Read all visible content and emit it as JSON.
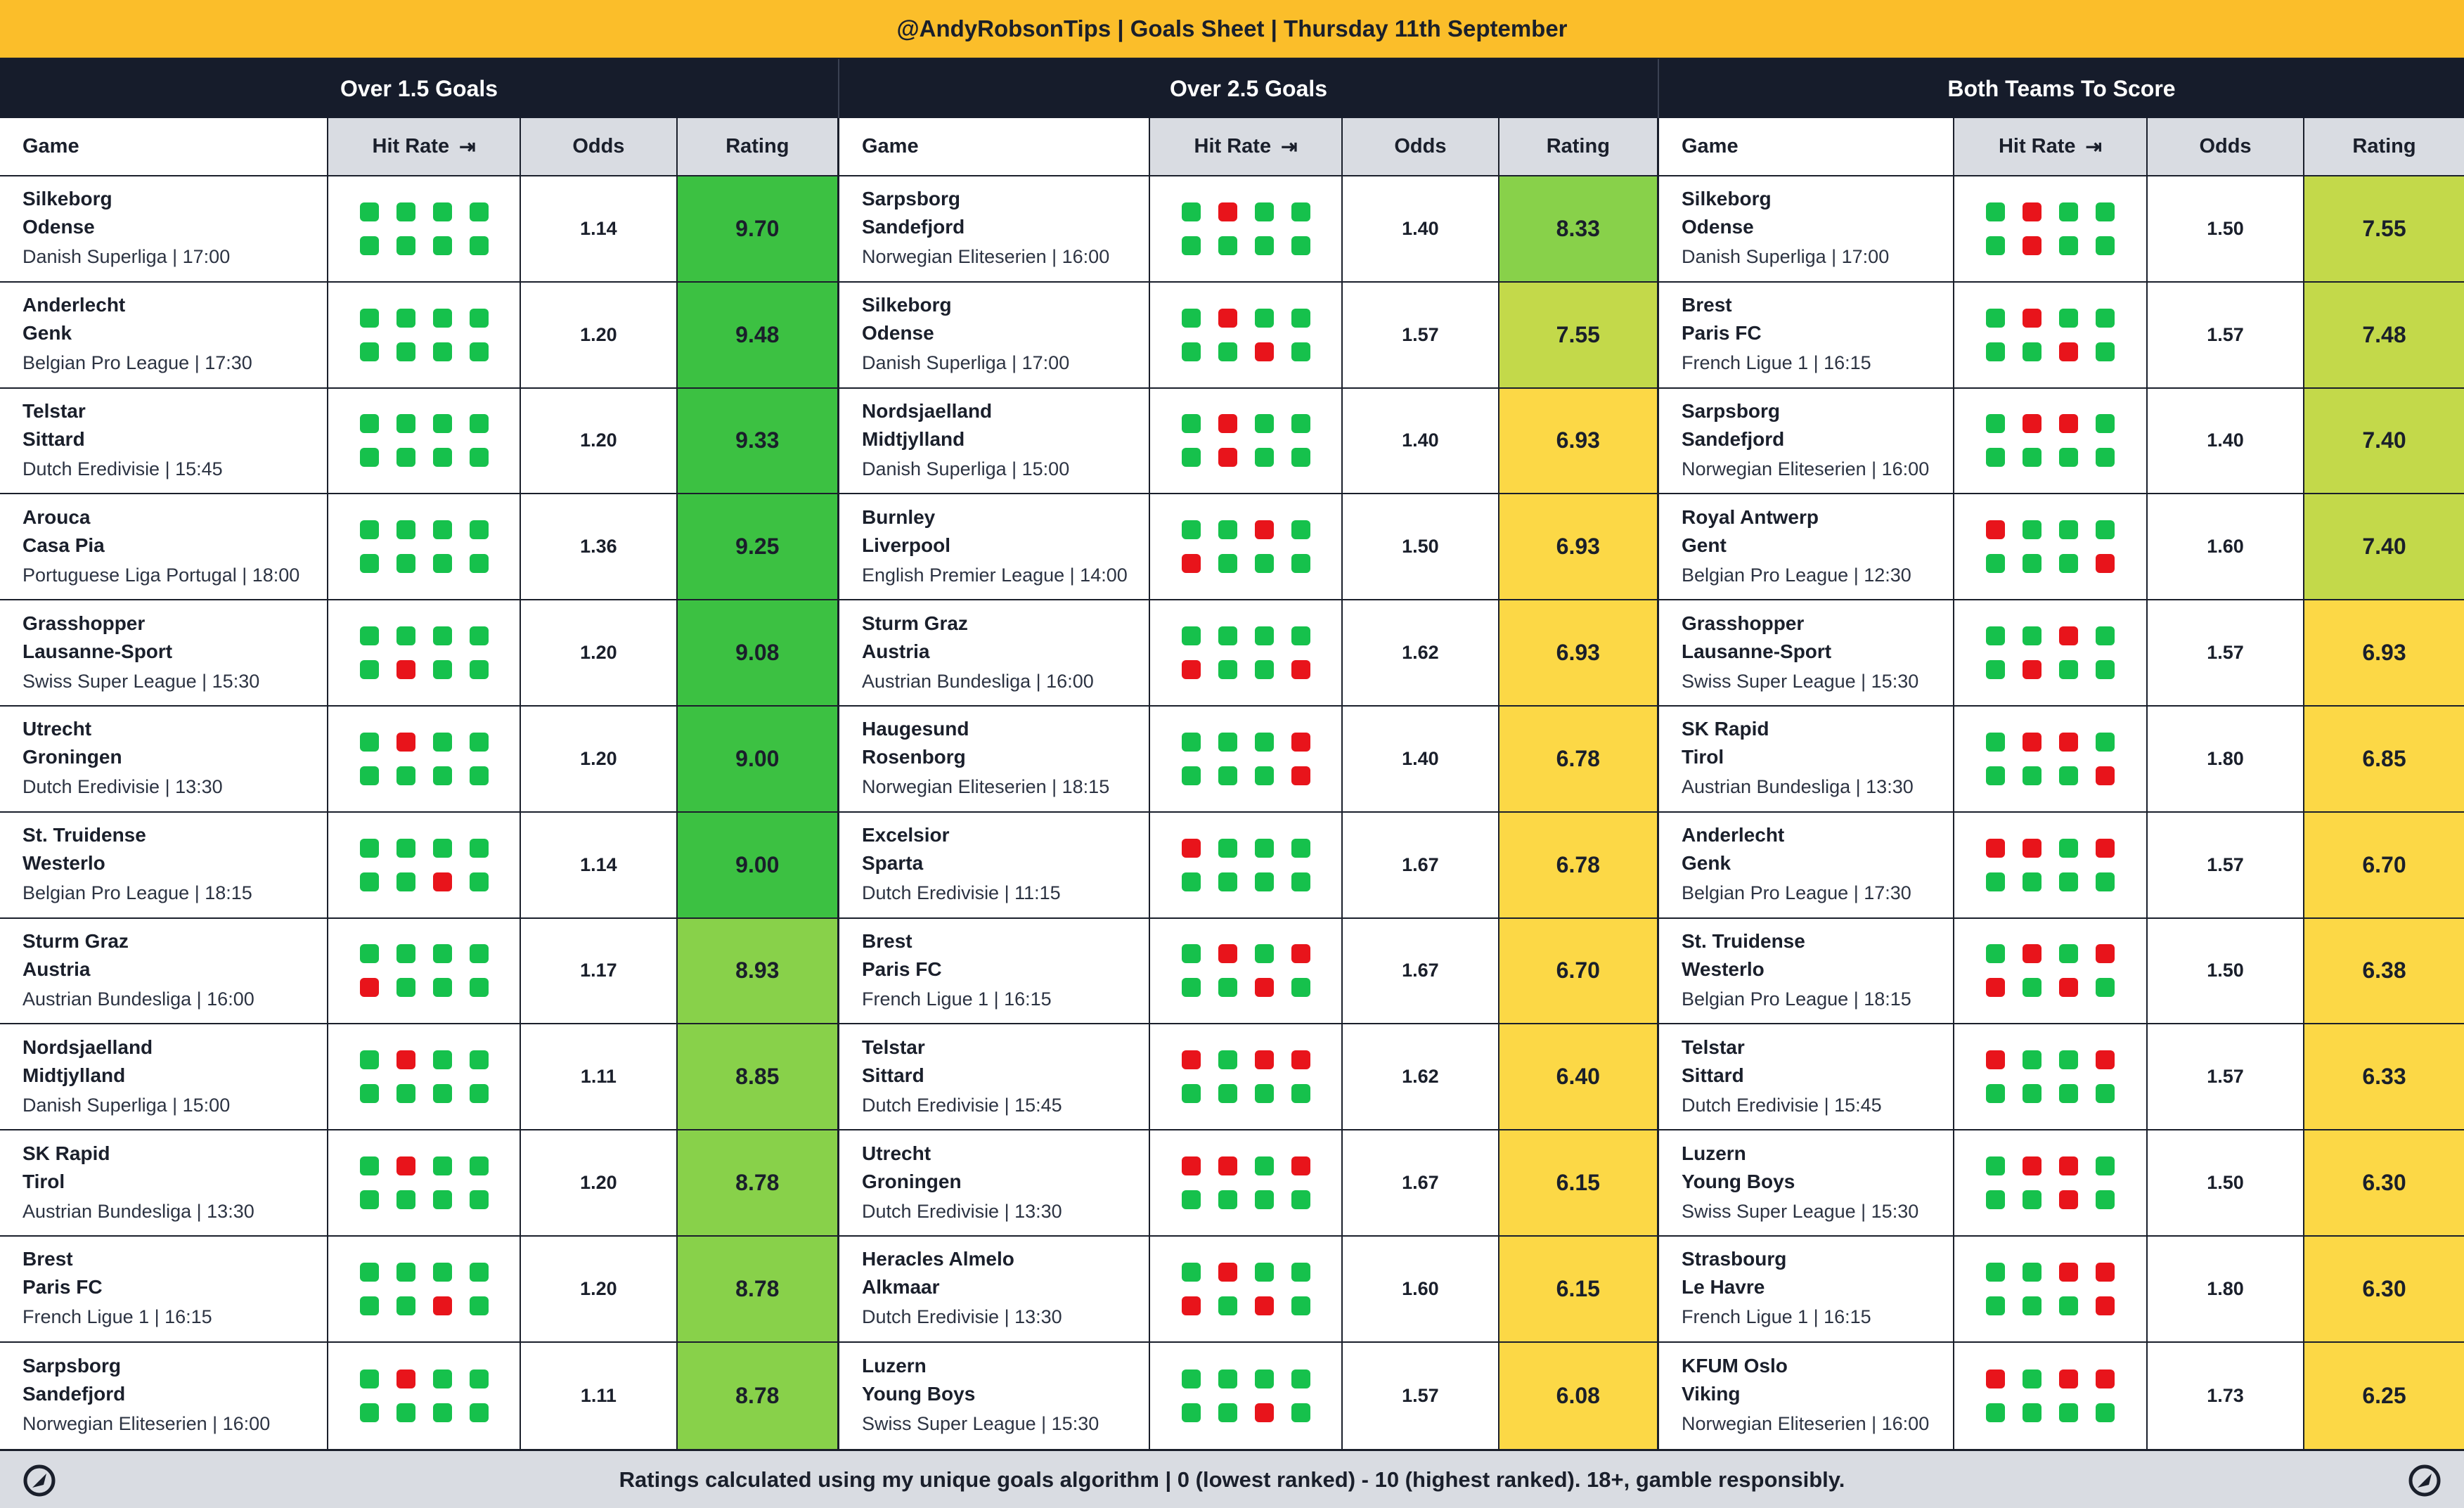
{
  "title": "@AndyRobsonTips | Goals Sheet | Thursday 11th September",
  "footer": "Ratings calculated using my unique goals algorithm | 0 (lowest ranked) - 10 (highest ranked). 18+, gamble responsibly.",
  "icons": {
    "logo": "brand-logo-icon",
    "hit_rate_arrow": "arrow-right-to-bar-icon"
  },
  "colors": {
    "hit": "#16c14c",
    "miss": "#e8141b",
    "title_bg": "#fbbe2a",
    "header_bg": "#161c2b",
    "rating_top": "#3cc142",
    "rating_mid": "#88d14a",
    "rating_low": "#c3d94a",
    "rating_yellow": "#fcd846"
  },
  "columns": {
    "game": "Game",
    "hit_rate": "Hit Rate",
    "hit_rate_arrow": "⇥",
    "odds": "Odds",
    "rating": "Rating"
  },
  "sections": [
    {
      "title": "Over 1.5 Goals",
      "rows": [
        {
          "home": "Silkeborg",
          "away": "Odense",
          "league": "Danish Superliga | 17:00",
          "hits": [
            "g",
            "g",
            "g",
            "g",
            "g",
            "g",
            "g",
            "g"
          ],
          "odds": "1.14",
          "rating": "9.70",
          "color": "#3cc142"
        },
        {
          "home": "Anderlecht",
          "away": "Genk",
          "league": "Belgian Pro League | 17:30",
          "hits": [
            "g",
            "g",
            "g",
            "g",
            "g",
            "g",
            "g",
            "g"
          ],
          "odds": "1.20",
          "rating": "9.48",
          "color": "#3cc142"
        },
        {
          "home": "Telstar",
          "away": "Sittard",
          "league": "Dutch Eredivisie | 15:45",
          "hits": [
            "g",
            "g",
            "g",
            "g",
            "g",
            "g",
            "g",
            "g"
          ],
          "odds": "1.20",
          "rating": "9.33",
          "color": "#3cc142"
        },
        {
          "home": "Arouca",
          "away": "Casa Pia",
          "league": "Portuguese Liga Portugal | 18:00",
          "hits": [
            "g",
            "g",
            "g",
            "g",
            "g",
            "g",
            "g",
            "g"
          ],
          "odds": "1.36",
          "rating": "9.25",
          "color": "#3cc142"
        },
        {
          "home": "Grasshopper",
          "away": "Lausanne-Sport",
          "league": "Swiss Super League | 15:30",
          "hits": [
            "g",
            "g",
            "g",
            "g",
            "g",
            "r",
            "g",
            "g"
          ],
          "odds": "1.20",
          "rating": "9.08",
          "color": "#3cc142"
        },
        {
          "home": "Utrecht",
          "away": "Groningen",
          "league": "Dutch Eredivisie | 13:30",
          "hits": [
            "g",
            "r",
            "g",
            "g",
            "g",
            "g",
            "g",
            "g"
          ],
          "odds": "1.20",
          "rating": "9.00",
          "color": "#3cc142"
        },
        {
          "home": "St. Truidense",
          "away": "Westerlo",
          "league": "Belgian Pro League | 18:15",
          "hits": [
            "g",
            "g",
            "g",
            "g",
            "g",
            "g",
            "r",
            "g"
          ],
          "odds": "1.14",
          "rating": "9.00",
          "color": "#3cc142"
        },
        {
          "home": "Sturm Graz",
          "away": "Austria",
          "league": "Austrian Bundesliga | 16:00",
          "hits": [
            "g",
            "g",
            "g",
            "g",
            "r",
            "g",
            "g",
            "g"
          ],
          "odds": "1.17",
          "rating": "8.93",
          "color": "#88d14a"
        },
        {
          "home": "Nordsjaelland",
          "away": "Midtjylland",
          "league": "Danish Superliga | 15:00",
          "hits": [
            "g",
            "r",
            "g",
            "g",
            "g",
            "g",
            "g",
            "g"
          ],
          "odds": "1.11",
          "rating": "8.85",
          "color": "#88d14a"
        },
        {
          "home": "SK Rapid",
          "away": "Tirol",
          "league": "Austrian Bundesliga | 13:30",
          "hits": [
            "g",
            "r",
            "g",
            "g",
            "g",
            "g",
            "g",
            "g"
          ],
          "odds": "1.20",
          "rating": "8.78",
          "color": "#88d14a"
        },
        {
          "home": "Brest",
          "away": "Paris FC",
          "league": "French Ligue 1 | 16:15",
          "hits": [
            "g",
            "g",
            "g",
            "g",
            "g",
            "g",
            "r",
            "g"
          ],
          "odds": "1.20",
          "rating": "8.78",
          "color": "#88d14a"
        },
        {
          "home": "Sarpsborg",
          "away": "Sandefjord",
          "league": "Norwegian Eliteserien | 16:00",
          "hits": [
            "g",
            "r",
            "g",
            "g",
            "g",
            "g",
            "g",
            "g"
          ],
          "odds": "1.11",
          "rating": "8.78",
          "color": "#88d14a"
        }
      ]
    },
    {
      "title": "Over 2.5 Goals",
      "rows": [
        {
          "home": "Sarpsborg",
          "away": "Sandefjord",
          "league": "Norwegian Eliteserien | 16:00",
          "hits": [
            "g",
            "r",
            "g",
            "g",
            "g",
            "g",
            "g",
            "g"
          ],
          "odds": "1.40",
          "rating": "8.33",
          "color": "#88d14a"
        },
        {
          "home": "Silkeborg",
          "away": "Odense",
          "league": "Danish Superliga | 17:00",
          "hits": [
            "g",
            "r",
            "g",
            "g",
            "g",
            "g",
            "r",
            "g"
          ],
          "odds": "1.57",
          "rating": "7.55",
          "color": "#c3d94a"
        },
        {
          "home": "Nordsjaelland",
          "away": "Midtjylland",
          "league": "Danish Superliga | 15:00",
          "hits": [
            "g",
            "r",
            "g",
            "g",
            "g",
            "r",
            "g",
            "g"
          ],
          "odds": "1.40",
          "rating": "6.93",
          "color": "#fcd846"
        },
        {
          "home": "Burnley",
          "away": "Liverpool",
          "league": "English Premier League | 14:00",
          "hits": [
            "g",
            "g",
            "r",
            "g",
            "r",
            "g",
            "g",
            "g"
          ],
          "odds": "1.50",
          "rating": "6.93",
          "color": "#fcd846"
        },
        {
          "home": "Sturm Graz",
          "away": "Austria",
          "league": "Austrian Bundesliga | 16:00",
          "hits": [
            "g",
            "g",
            "g",
            "g",
            "r",
            "g",
            "g",
            "r"
          ],
          "odds": "1.62",
          "rating": "6.93",
          "color": "#fcd846"
        },
        {
          "home": "Haugesund",
          "away": "Rosenborg",
          "league": "Norwegian Eliteserien | 18:15",
          "hits": [
            "g",
            "g",
            "g",
            "r",
            "g",
            "g",
            "g",
            "r"
          ],
          "odds": "1.40",
          "rating": "6.78",
          "color": "#fcd846"
        },
        {
          "home": "Excelsior",
          "away": "Sparta",
          "league": "Dutch Eredivisie | 11:15",
          "hits": [
            "r",
            "g",
            "g",
            "g",
            "g",
            "g",
            "g",
            "g"
          ],
          "odds": "1.67",
          "rating": "6.78",
          "color": "#fcd846"
        },
        {
          "home": "Brest",
          "away": "Paris FC",
          "league": "French Ligue 1 | 16:15",
          "hits": [
            "g",
            "r",
            "g",
            "r",
            "g",
            "g",
            "r",
            "g"
          ],
          "odds": "1.67",
          "rating": "6.70",
          "color": "#fcd846"
        },
        {
          "home": "Telstar",
          "away": "Sittard",
          "league": "Dutch Eredivisie | 15:45",
          "hits": [
            "r",
            "g",
            "r",
            "r",
            "g",
            "g",
            "g",
            "g"
          ],
          "odds": "1.62",
          "rating": "6.40",
          "color": "#fcd846"
        },
        {
          "home": "Utrecht",
          "away": "Groningen",
          "league": "Dutch Eredivisie | 13:30",
          "hits": [
            "r",
            "r",
            "g",
            "r",
            "g",
            "g",
            "g",
            "g"
          ],
          "odds": "1.67",
          "rating": "6.15",
          "color": "#fcd846"
        },
        {
          "home": "Heracles Almelo",
          "away": "Alkmaar",
          "league": "Dutch Eredivisie | 13:30",
          "hits": [
            "g",
            "r",
            "g",
            "g",
            "r",
            "g",
            "r",
            "g"
          ],
          "odds": "1.60",
          "rating": "6.15",
          "color": "#fcd846"
        },
        {
          "home": "Luzern",
          "away": "Young Boys",
          "league": "Swiss Super League | 15:30",
          "hits": [
            "g",
            "g",
            "g",
            "g",
            "g",
            "g",
            "r",
            "g"
          ],
          "odds": "1.57",
          "rating": "6.08",
          "color": "#fcd846"
        }
      ]
    },
    {
      "title": "Both Teams To Score",
      "rows": [
        {
          "home": "Silkeborg",
          "away": "Odense",
          "league": "Danish Superliga | 17:00",
          "hits": [
            "g",
            "r",
            "g",
            "g",
            "g",
            "r",
            "g",
            "g"
          ],
          "odds": "1.50",
          "rating": "7.55",
          "color": "#c3d94a"
        },
        {
          "home": "Brest",
          "away": "Paris FC",
          "league": "French Ligue 1 | 16:15",
          "hits": [
            "g",
            "r",
            "g",
            "g",
            "g",
            "g",
            "r",
            "g"
          ],
          "odds": "1.57",
          "rating": "7.48",
          "color": "#c3d94a"
        },
        {
          "home": "Sarpsborg",
          "away": "Sandefjord",
          "league": "Norwegian Eliteserien | 16:00",
          "hits": [
            "g",
            "r",
            "r",
            "g",
            "g",
            "g",
            "g",
            "g"
          ],
          "odds": "1.40",
          "rating": "7.40",
          "color": "#c3d94a"
        },
        {
          "home": "Royal Antwerp",
          "away": "Gent",
          "league": "Belgian Pro League | 12:30",
          "hits": [
            "r",
            "g",
            "g",
            "g",
            "g",
            "g",
            "g",
            "r"
          ],
          "odds": "1.60",
          "rating": "7.40",
          "color": "#c3d94a"
        },
        {
          "home": "Grasshopper",
          "away": "Lausanne-Sport",
          "league": "Swiss Super League | 15:30",
          "hits": [
            "g",
            "g",
            "r",
            "g",
            "g",
            "r",
            "g",
            "g"
          ],
          "odds": "1.57",
          "rating": "6.93",
          "color": "#fcd846"
        },
        {
          "home": "SK Rapid",
          "away": "Tirol",
          "league": "Austrian Bundesliga | 13:30",
          "hits": [
            "g",
            "r",
            "r",
            "g",
            "g",
            "g",
            "g",
            "r"
          ],
          "odds": "1.80",
          "rating": "6.85",
          "color": "#fcd846"
        },
        {
          "home": "Anderlecht",
          "away": "Genk",
          "league": "Belgian Pro League | 17:30",
          "hits": [
            "r",
            "r",
            "g",
            "r",
            "g",
            "g",
            "g",
            "g"
          ],
          "odds": "1.57",
          "rating": "6.70",
          "color": "#fcd846"
        },
        {
          "home": "St. Truidense",
          "away": "Westerlo",
          "league": "Belgian Pro League | 18:15",
          "hits": [
            "g",
            "r",
            "g",
            "r",
            "r",
            "g",
            "r",
            "g"
          ],
          "odds": "1.50",
          "rating": "6.38",
          "color": "#fcd846"
        },
        {
          "home": "Telstar",
          "away": "Sittard",
          "league": "Dutch Eredivisie | 15:45",
          "hits": [
            "r",
            "g",
            "g",
            "r",
            "g",
            "g",
            "g",
            "g"
          ],
          "odds": "1.57",
          "rating": "6.33",
          "color": "#fcd846"
        },
        {
          "home": "Luzern",
          "away": "Young Boys",
          "league": "Swiss Super League | 15:30",
          "hits": [
            "g",
            "r",
            "r",
            "g",
            "g",
            "g",
            "r",
            "g"
          ],
          "odds": "1.50",
          "rating": "6.30",
          "color": "#fcd846"
        },
        {
          "home": "Strasbourg",
          "away": "Le Havre",
          "league": "French Ligue 1 | 16:15",
          "hits": [
            "g",
            "g",
            "r",
            "r",
            "g",
            "g",
            "g",
            "r"
          ],
          "odds": "1.80",
          "rating": "6.30",
          "color": "#fcd846"
        },
        {
          "home": "KFUM Oslo",
          "away": "Viking",
          "league": "Norwegian Eliteserien | 16:00",
          "hits": [
            "r",
            "g",
            "r",
            "r",
            "g",
            "g",
            "g",
            "g"
          ],
          "odds": "1.73",
          "rating": "6.25",
          "color": "#fcd846"
        }
      ]
    }
  ]
}
